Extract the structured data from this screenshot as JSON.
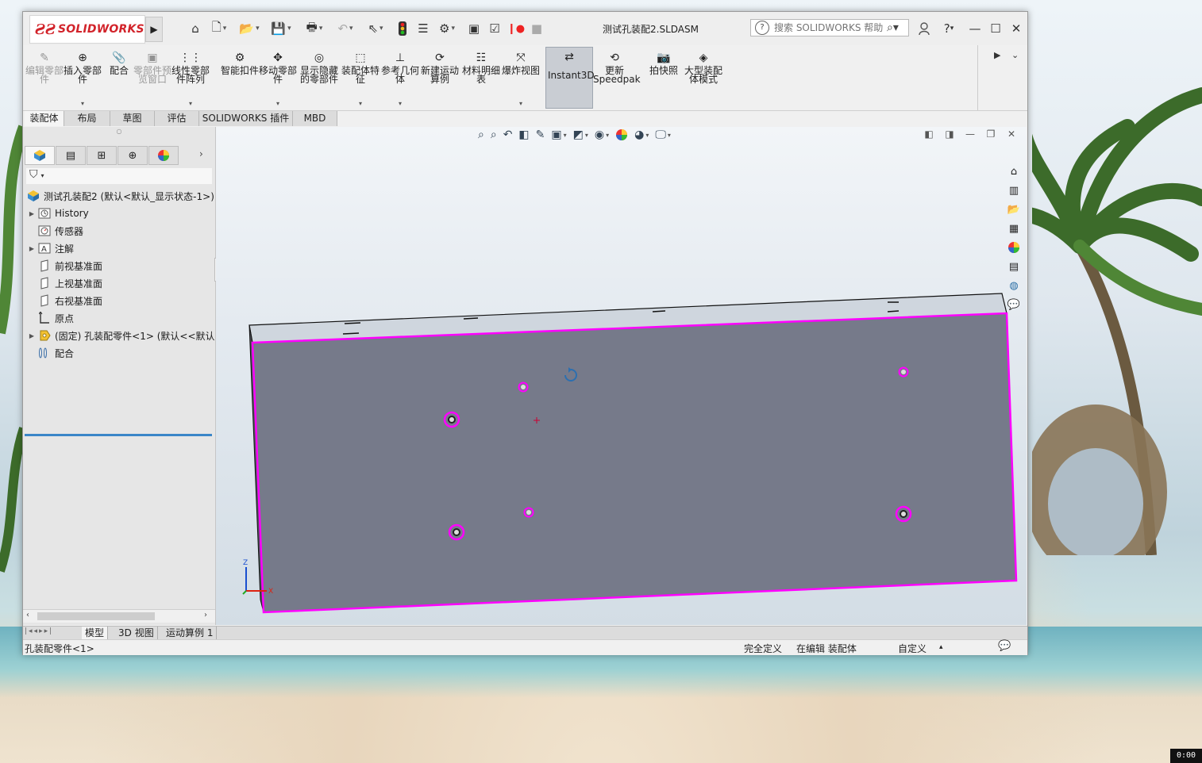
{
  "window": {
    "brand": "SOLIDWORKS",
    "document_title": "测试孔装配2.SLDASM",
    "help_search": {
      "placeholder": "搜索 SOLIDWORKS 帮助"
    },
    "quick_access_icons": [
      "home-icon",
      "new-document-icon",
      "open-icon",
      "save-icon",
      "print-icon",
      "undo-icon",
      "select-icon",
      "traffic-light-icon",
      "file-properties-icon",
      "options-gear-icon",
      "rebuild-icon",
      "checklist-icon",
      "record-icon",
      "stop-icon"
    ],
    "window_buttons": {
      "user": "user-icon",
      "help": "?",
      "minimize": "—",
      "maximize": "☐",
      "close": "✕"
    }
  },
  "command_manager": {
    "buttons": [
      {
        "label": "编辑零部件",
        "icon": "edit-component-icon",
        "disabled": true,
        "dropdown": false
      },
      {
        "label": "插入零部件",
        "icon": "insert-component-icon",
        "disabled": false,
        "dropdown": true
      },
      {
        "label": "配合",
        "icon": "mate-icon",
        "disabled": false,
        "dropdown": false
      },
      {
        "label": "零部件预览窗口",
        "icon": "component-preview-icon",
        "disabled": true,
        "dropdown": false
      },
      {
        "label": "线性零部件阵列",
        "icon": "linear-pattern-icon",
        "disabled": false,
        "dropdown": true
      },
      {
        "label": "智能扣件",
        "icon": "smart-fastener-icon",
        "disabled": false,
        "dropdown": false
      },
      {
        "label": "移动零部件",
        "icon": "move-component-icon",
        "disabled": false,
        "dropdown": true
      },
      {
        "label": "显示隐藏的零部件",
        "icon": "show-hidden-icon",
        "disabled": false,
        "dropdown": false
      },
      {
        "label": "装配体特征",
        "icon": "assembly-feature-icon",
        "disabled": false,
        "dropdown": true
      },
      {
        "label": "参考几何体",
        "icon": "reference-geometry-icon",
        "disabled": false,
        "dropdown": true
      },
      {
        "label": "新建运动算例",
        "icon": "new-motion-study-icon",
        "disabled": false,
        "dropdown": false
      },
      {
        "label": "材料明细表",
        "icon": "bom-icon",
        "disabled": false,
        "dropdown": false
      },
      {
        "label": "爆炸视图",
        "icon": "exploded-view-icon",
        "disabled": false,
        "dropdown": true
      },
      {
        "label": "Instant3D",
        "icon": "instant3d-icon",
        "disabled": false,
        "dropdown": false,
        "active": true
      },
      {
        "label": "更新Speedpak",
        "icon": "speedpak-icon",
        "disabled": false,
        "dropdown": false
      },
      {
        "label": "拍快照",
        "icon": "snapshot-icon",
        "disabled": false,
        "dropdown": false
      },
      {
        "label": "大型装配体模式",
        "icon": "large-assembly-icon",
        "disabled": false,
        "dropdown": false
      }
    ]
  },
  "tabs": [
    "装配体",
    "布局",
    "草图",
    "评估",
    "SOLIDWORKS 插件",
    "MBD"
  ],
  "feature_tree": {
    "root": "测试孔装配2 (默认<默认_显示状态-1>)",
    "items": [
      {
        "label": "History",
        "icon": "history-icon",
        "expandable": true
      },
      {
        "label": "传感器",
        "icon": "sensor-icon",
        "expandable": false
      },
      {
        "label": "注解",
        "icon": "annotation-icon",
        "expandable": true
      },
      {
        "label": "前视基准面",
        "icon": "plane-icon",
        "expandable": false
      },
      {
        "label": "上视基准面",
        "icon": "plane-icon",
        "expandable": false
      },
      {
        "label": "右视基准面",
        "icon": "plane-icon",
        "expandable": false
      },
      {
        "label": "原点",
        "icon": "origin-icon",
        "expandable": false
      },
      {
        "label": "(固定) 孔装配零件<1> (默认<<默认",
        "icon": "part-icon",
        "expandable": true
      },
      {
        "label": "配合",
        "icon": "mates-folder-icon",
        "expandable": false
      }
    ]
  },
  "model_tabs": [
    "模型",
    "3D 视图",
    "运动算例 1"
  ],
  "status": {
    "selection": "孔装配零件<1>",
    "definition": "完全定义",
    "mode": "在编辑 装配体",
    "units": "自定义",
    "units_arrow": "▴"
  },
  "clock": "0:00",
  "colors": {
    "accent": "#d2232a",
    "selection": "#ff00ff",
    "part_face": "#767a8a",
    "tree_bar": "#3a86c8"
  }
}
